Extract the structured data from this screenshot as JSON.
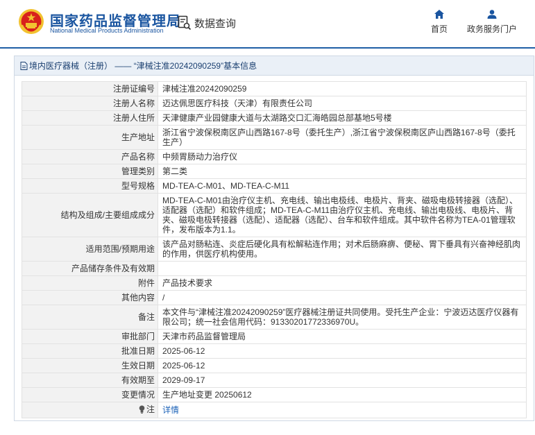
{
  "header": {
    "brand_cn": "国家药品监督管理局",
    "brand_en": "National Medical Products Administration",
    "query_label": "数据查询",
    "nav_home": "首页",
    "nav_service": "政务服务门户"
  },
  "panel": {
    "crumb_category": "境内医疗器械（注册）",
    "crumb_separator": " —— ",
    "crumb_title": "“津械注准20242090259”基本信息"
  },
  "rows": [
    {
      "key": "注册证编号",
      "value": "津械注准20242090259"
    },
    {
      "key": "注册人名称",
      "value": "迈达佩思医疗科技（天津）有限责任公司"
    },
    {
      "key": "注册人住所",
      "value": "天津健康产业园健康大道与太湖路交口汇海皓园总部基地5号楼"
    },
    {
      "key": "生产地址",
      "value": "浙江省宁波保税南区庐山西路167-8号（委托生产）,浙江省宁波保税南区庐山西路167-8号（委托生产）"
    },
    {
      "key": "产品名称",
      "value": "中频胃肠动力治疗仪"
    },
    {
      "key": "管理类别",
      "value": "第二类"
    },
    {
      "key": "型号规格",
      "value": "MD-TEA-C-M01、MD-TEA-C-M11"
    },
    {
      "key": "结构及组成/主要组成成分",
      "value": "MD-TEA-C-M01由治疗仪主机、充电线、输出电极线、电极片、背夹、磁吸电极转接器（选配）、适配器（选配）和软件组成；MD-TEA-C-M11由治疗仪主机、充电线、输出电极线、电极片、背夹、磁吸电极转接器（选配）、适配器（选配）、台车和软件组成。其中软件名称为TEA-01管理软件，发布版本为1.1。"
    },
    {
      "key": "适用范围/预期用途",
      "value": "该产品对肠粘连、炎症后硬化具有松解粘连作用；对术后肠麻痹、便秘、胃下垂具有兴奋神经肌肉的作用，供医疗机构使用。"
    },
    {
      "key": "产品储存条件及有效期",
      "value": ""
    },
    {
      "key": "附件",
      "value": "产品技术要求"
    },
    {
      "key": "其他内容",
      "value": "/"
    },
    {
      "key": "备注",
      "value": "本文件与“津械注准20242090259”医疗器械注册证共同使用。受托生产企业：宁波迈达医疗仪器有限公司；统一社会信用代码：91330201772336970U。"
    },
    {
      "key": "审批部门",
      "value": "天津市药品监督管理局"
    },
    {
      "key": "批准日期",
      "value": "2025-06-12"
    },
    {
      "key": "生效日期",
      "value": "2025-06-12"
    },
    {
      "key": "有效期至",
      "value": "2029-09-17"
    },
    {
      "key": "变更情况",
      "value": "生产地址变更 20250612"
    }
  ],
  "note": {
    "key": "注",
    "value": "详情"
  },
  "colors": {
    "brand_blue": "#1a55a0",
    "link_blue": "#1d63b8",
    "emblem_red": "#d8201c",
    "emblem_gold": "#f2c230"
  },
  "icons": {
    "emblem": "national-emblem-icon",
    "query": "search-document-icon",
    "home": "home-icon",
    "service": "user-icon",
    "crumb": "document-icon",
    "note": "lightbulb-icon"
  }
}
